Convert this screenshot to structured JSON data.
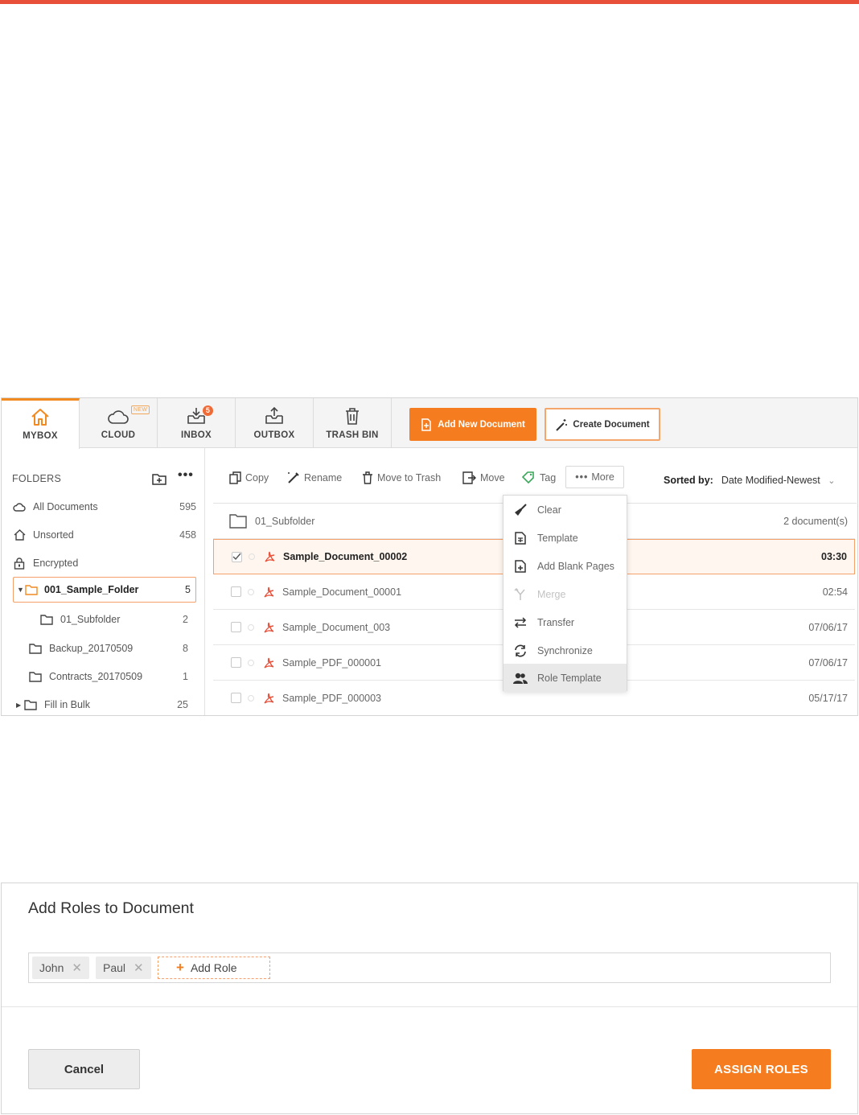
{
  "tabs": [
    {
      "label": "MYBOX",
      "icon": "home-icon",
      "active": true
    },
    {
      "label": "CLOUD",
      "icon": "cloud-icon",
      "badge": "NEW"
    },
    {
      "label": "INBOX",
      "icon": "inbox-icon",
      "badge": "5"
    },
    {
      "label": "OUTBOX",
      "icon": "outbox-icon"
    },
    {
      "label": "TRASH BIN",
      "icon": "trash-icon"
    }
  ],
  "header_buttons": {
    "add_new_document": "Add New Document",
    "create_document": "Create Document"
  },
  "sidebar": {
    "heading": "FOLDERS",
    "more": "•••",
    "items": [
      {
        "label": "All Documents",
        "count": "595",
        "icon": "cloud-icon"
      },
      {
        "label": "Unsorted",
        "count": "458",
        "icon": "home-icon"
      },
      {
        "label": "Encrypted",
        "count": "",
        "icon": "lock-icon"
      },
      {
        "label": "001_Sample_Folder",
        "count": "5",
        "icon": "folder-icon",
        "selected": true,
        "expanded": true
      },
      {
        "label": "01_Subfolder",
        "count": "2",
        "icon": "folder-icon"
      },
      {
        "label": "Backup_20170509",
        "count": "8",
        "icon": "folder-icon"
      },
      {
        "label": "Contracts_20170509",
        "count": "1",
        "icon": "folder-icon"
      },
      {
        "label": "Fill in Bulk",
        "count": "25",
        "icon": "folder-icon",
        "collapsed": true
      }
    ]
  },
  "toolbar": {
    "copy": "Copy",
    "rename": "Rename",
    "move_to_trash": "Move to Trash",
    "move": "Move",
    "tag": "Tag",
    "more": "More",
    "sorted_by_label": "Sorted by:",
    "sorted_by_value": "Date Modified-Newest"
  },
  "documents": {
    "folder_row": {
      "name": "01_Subfolder",
      "info": "2 document(s)"
    },
    "rows": [
      {
        "name": "Sample_Document_00002",
        "date": "03:30",
        "selected": true
      },
      {
        "name": "Sample_Document_00001",
        "date": "02:54"
      },
      {
        "name": "Sample_Document_003",
        "date": "07/06/17"
      },
      {
        "name": "Sample_PDF_000001",
        "date": "07/06/17"
      },
      {
        "name": "Sample_PDF_000003",
        "date": "05/17/17"
      }
    ]
  },
  "more_menu": [
    {
      "label": "Clear",
      "icon": "broom-icon"
    },
    {
      "label": "Template",
      "icon": "template-icon"
    },
    {
      "label": "Add Blank Pages",
      "icon": "add-page-icon"
    },
    {
      "label": "Merge",
      "icon": "merge-icon",
      "disabled": true
    },
    {
      "label": "Transfer",
      "icon": "transfer-icon"
    },
    {
      "label": "Synchronize",
      "icon": "sync-icon"
    },
    {
      "label": "Role Template",
      "icon": "users-icon",
      "hover": true
    }
  ],
  "dialog": {
    "title": "Add Roles to Document",
    "roles": [
      "John",
      "Paul"
    ],
    "add_role": "Add Role",
    "cancel": "Cancel",
    "assign": "ASSIGN ROLES"
  },
  "colors": {
    "accent": "#f57c1f",
    "top_bar": "#e8503a",
    "selection_border": "#f5a06a"
  }
}
